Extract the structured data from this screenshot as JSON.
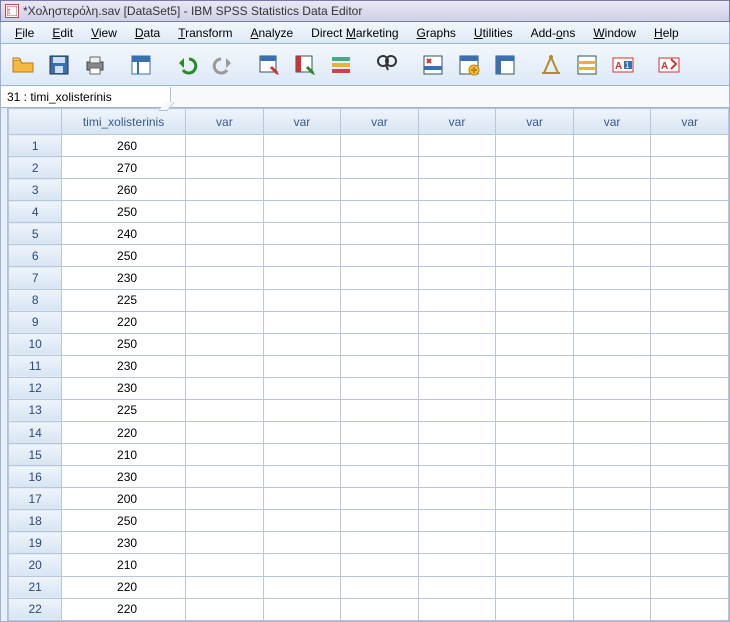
{
  "window": {
    "title": "*Χοληστερόλη.sav [DataSet5] - IBM SPSS Statistics Data Editor"
  },
  "menus": [
    {
      "label": "File",
      "u": 0
    },
    {
      "label": "Edit",
      "u": 0
    },
    {
      "label": "View",
      "u": 0
    },
    {
      "label": "Data",
      "u": 0
    },
    {
      "label": "Transform",
      "u": 0
    },
    {
      "label": "Analyze",
      "u": 0
    },
    {
      "label": "Direct Marketing",
      "u": 7
    },
    {
      "label": "Graphs",
      "u": 0
    },
    {
      "label": "Utilities",
      "u": 0
    },
    {
      "label": "Add-ons",
      "u": 4
    },
    {
      "label": "Window",
      "u": 0
    },
    {
      "label": "Help",
      "u": 0
    }
  ],
  "cell_reference": "31 : timi_xolisterinis",
  "columns": {
    "data_col": "timi_xolisterinis",
    "var_placeholder": "var",
    "var_count": 7
  },
  "rows": [
    {
      "n": 1,
      "v": "260"
    },
    {
      "n": 2,
      "v": "270"
    },
    {
      "n": 3,
      "v": "260"
    },
    {
      "n": 4,
      "v": "250"
    },
    {
      "n": 5,
      "v": "240"
    },
    {
      "n": 6,
      "v": "250"
    },
    {
      "n": 7,
      "v": "230"
    },
    {
      "n": 8,
      "v": "225"
    },
    {
      "n": 9,
      "v": "220"
    },
    {
      "n": 10,
      "v": "250"
    },
    {
      "n": 11,
      "v": "230"
    },
    {
      "n": 12,
      "v": "230"
    },
    {
      "n": 13,
      "v": "225"
    },
    {
      "n": 14,
      "v": "220"
    },
    {
      "n": 15,
      "v": "210"
    },
    {
      "n": 16,
      "v": "230"
    },
    {
      "n": 17,
      "v": "200"
    },
    {
      "n": 18,
      "v": "250"
    },
    {
      "n": 19,
      "v": "230"
    },
    {
      "n": 20,
      "v": "210"
    },
    {
      "n": 21,
      "v": "220"
    },
    {
      "n": 22,
      "v": "220"
    }
  ],
  "toolbar_icons": [
    "open-icon",
    "save-icon",
    "print-icon",
    "sep",
    "recall-icon",
    "sep",
    "undo-icon",
    "redo-icon",
    "sep",
    "goto-case-icon",
    "goto-var-icon",
    "variables-icon",
    "sep",
    "find-icon",
    "sep",
    "insert-case-icon",
    "insert-var-icon",
    "split-icon",
    "sep",
    "weight-icon",
    "select-icon",
    "value-labels-icon",
    "sep",
    "use-sets-icon"
  ]
}
